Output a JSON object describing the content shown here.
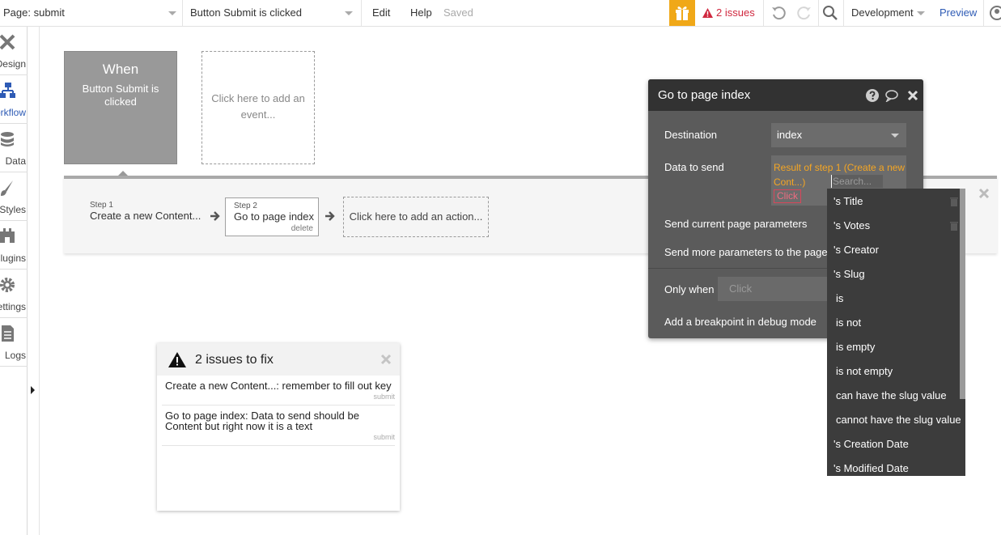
{
  "topbar": {
    "page_selector": "Page: submit",
    "event_selector": "Button Submit is clicked",
    "menu": [
      "Edit",
      "Help"
    ],
    "saved_status": "Saved",
    "issues_label": "2 issues",
    "version": "Development",
    "preview": "Preview",
    "colors": {
      "gift": "#f0a818",
      "issues": "#d0283f",
      "link": "#2e5bb5"
    }
  },
  "sidebar": {
    "items": [
      {
        "label": "Design",
        "icon": "design-icon"
      },
      {
        "label": "Workflow",
        "icon": "workflow-icon"
      },
      {
        "label": "Data",
        "icon": "data-icon"
      },
      {
        "label": "Styles",
        "icon": "styles-icon"
      },
      {
        "label": "Plugins",
        "icon": "plugins-icon"
      },
      {
        "label": "Settings",
        "icon": "settings-icon"
      },
      {
        "label": "Logs",
        "icon": "logs-icon"
      }
    ],
    "active_index": 1
  },
  "event": {
    "when": "When",
    "trigger": "Button Submit is clicked",
    "add_event": "Click here to add an event..."
  },
  "steps": {
    "step1_num": "Step 1",
    "step1_label": "Create a new Content...",
    "step2_num": "Step 2",
    "step2_label": "Go to page index",
    "step2_delete": "delete",
    "add_action": "Click here to add an action..."
  },
  "issues": {
    "title": "2 issues to fix",
    "items": [
      {
        "text": "Create a new Content...: remember to fill out key",
        "tag": "submit"
      },
      {
        "text": "Go to page index: Data to send should be Content but right now it is a text",
        "tag": "submit"
      }
    ]
  },
  "action_editor": {
    "title": "Go to page index",
    "destination_label": "Destination",
    "destination_value": "index",
    "data_to_send_label": "Data to send",
    "data_expression": "Result of step 1 (Create a new Cont...)",
    "search_placeholder": "Search...",
    "click_token": "Click",
    "send_params_label": "Send current page parameters",
    "send_more_label": "Send more parameters to the page",
    "only_when_label": "Only when",
    "only_when_value": "Click",
    "breakpoint_label": "Add a breakpoint in debug mode"
  },
  "expression_menu": {
    "items": [
      "'s Title",
      "'s Votes",
      "'s Creator",
      "'s Slug",
      "is",
      "is not",
      "is empty",
      "is not empty",
      "can have the slug value",
      "cannot have the slug value",
      "'s Creation Date",
      "'s Modified Date"
    ]
  }
}
